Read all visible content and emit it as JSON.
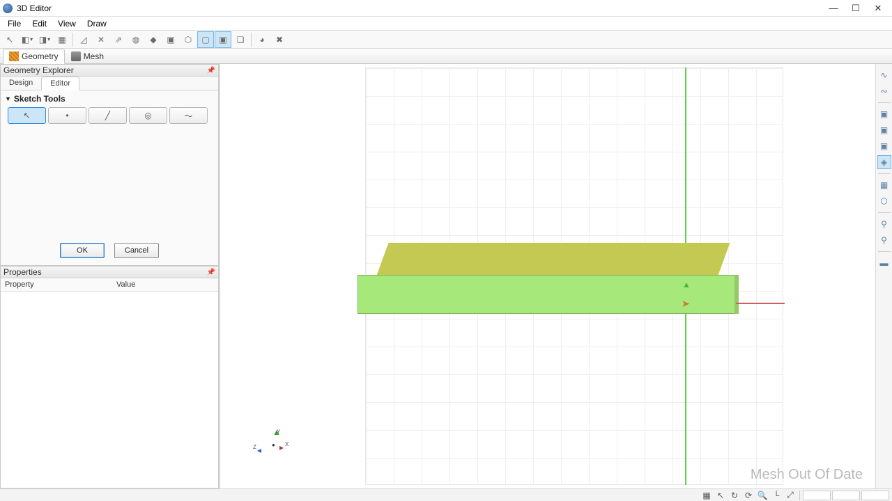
{
  "window": {
    "title": "3D Editor"
  },
  "menu": {
    "items": [
      "File",
      "Edit",
      "View",
      "Draw"
    ]
  },
  "toolbar": {
    "tools": [
      {
        "name": "select",
        "icon": "↖"
      },
      {
        "name": "new-solid",
        "icon": "◧",
        "dropdown": true
      },
      {
        "name": "primitive",
        "icon": "◨",
        "dropdown": true
      },
      {
        "name": "group",
        "icon": "▦"
      },
      {
        "name": "sep"
      },
      {
        "name": "sketch",
        "icon": "◿"
      },
      {
        "name": "axes",
        "icon": "✕"
      },
      {
        "name": "extrude",
        "icon": "⇗"
      },
      {
        "name": "revolve",
        "icon": "◍"
      },
      {
        "name": "sweep",
        "icon": "◆"
      },
      {
        "name": "loft",
        "icon": "▣"
      },
      {
        "name": "hex",
        "icon": "⬡"
      },
      {
        "name": "box",
        "icon": "▢",
        "active": true
      },
      {
        "name": "boxes",
        "icon": "▣",
        "active": true
      },
      {
        "name": "copy",
        "icon": "❏"
      },
      {
        "name": "sep"
      },
      {
        "name": "material",
        "icon": "◕"
      },
      {
        "name": "settings",
        "icon": "✖"
      }
    ]
  },
  "mode_tabs": [
    {
      "label": "Geometry",
      "active": true
    },
    {
      "label": "Mesh",
      "active": false
    }
  ],
  "explorer": {
    "title": "Geometry Explorer",
    "tabs": [
      {
        "label": "Design",
        "active": false
      },
      {
        "label": "Editor",
        "active": true
      }
    ],
    "section": "Sketch Tools",
    "sketch_tools": [
      {
        "name": "pointer",
        "icon": "↖",
        "active": true
      },
      {
        "name": "point",
        "icon": "•"
      },
      {
        "name": "line",
        "icon": "╱"
      },
      {
        "name": "circle",
        "icon": "◎"
      },
      {
        "name": "arc",
        "icon": "〜"
      }
    ],
    "buttons": {
      "ok": "OK",
      "cancel": "Cancel"
    }
  },
  "properties": {
    "title": "Properties",
    "columns": [
      "Property",
      "Value"
    ]
  },
  "viewport": {
    "watermark": "Mesh Out Of Date",
    "axes": {
      "y": "Y",
      "z": "Z",
      "x": "X"
    }
  },
  "right_dock": {
    "items": [
      {
        "name": "wave",
        "icon": "∿"
      },
      {
        "name": "sine",
        "icon": "∾"
      },
      {
        "sep": true
      },
      {
        "name": "cube1",
        "icon": "▣"
      },
      {
        "name": "cube2",
        "icon": "▣"
      },
      {
        "name": "cube3",
        "icon": "▣"
      },
      {
        "name": "cube4",
        "icon": "◈",
        "sel": true
      },
      {
        "sep": true
      },
      {
        "name": "grid",
        "icon": "▦"
      },
      {
        "name": "hex2",
        "icon": "⬡"
      },
      {
        "sep": true
      },
      {
        "name": "inspect",
        "icon": "⚲"
      },
      {
        "name": "inspect2",
        "icon": "⚲"
      },
      {
        "sep": true
      },
      {
        "name": "palette",
        "icon": "▬"
      }
    ]
  },
  "statusbar": {
    "items": [
      {
        "name": "shaded",
        "icon": "▦"
      },
      {
        "name": "cursor",
        "icon": "↖"
      },
      {
        "name": "rotate",
        "icon": "↻"
      },
      {
        "name": "refresh",
        "icon": "⟳"
      },
      {
        "name": "zoom",
        "icon": "🔍"
      },
      {
        "name": "axes",
        "icon": "└"
      },
      {
        "name": "fit",
        "icon": "⤢"
      }
    ]
  }
}
